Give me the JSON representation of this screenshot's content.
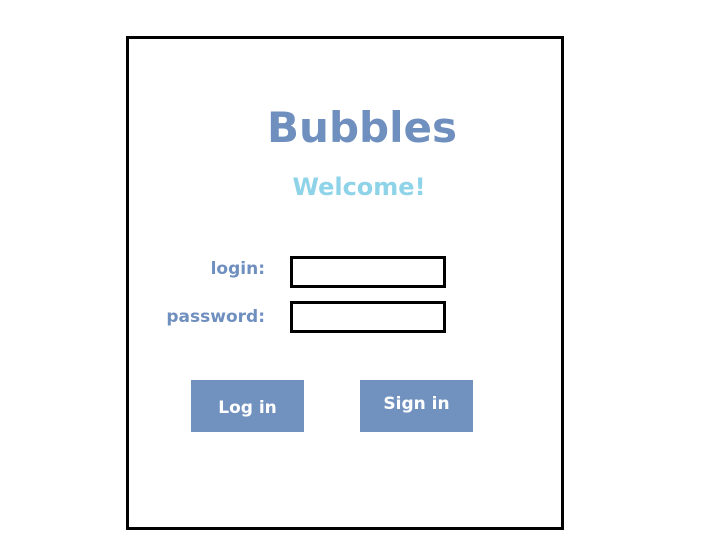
{
  "app": {
    "title": "Bubbles",
    "welcome": "Welcome!"
  },
  "form": {
    "login_label": "login:",
    "login_value": "",
    "password_label": "password:",
    "password_value": ""
  },
  "actions": {
    "login_button": "Log in",
    "signin_button": "Sign in"
  },
  "colors": {
    "brand": "#6f8fbf",
    "welcome": "#8fd3e8",
    "button_bg": "#7192bf",
    "button_text": "#ffffff",
    "border": "#000000"
  }
}
